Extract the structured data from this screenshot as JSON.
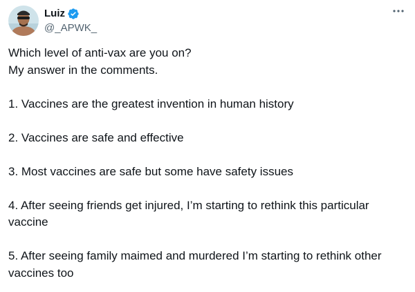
{
  "author": {
    "display_name": "Luiz",
    "handle": "@_APWK_",
    "verified": true,
    "avatar_icon": "profile-photo"
  },
  "post": {
    "intro": [
      "Which level of anti-vax are you on?",
      "My answer in the comments."
    ],
    "items": [
      "1. Vaccines are the greatest invention in human history",
      "2. Vaccines are safe and effective",
      "3. Most vaccines are safe but some have safety issues",
      "4. After seeing friends get injured, I’m starting to rethink this particular vaccine",
      "5. After seeing family maimed and murdered I’m starting to rethink other vaccines too"
    ]
  },
  "colors": {
    "text": "#0f1419",
    "secondary": "#536471",
    "verified_badge": "#1d9bf0"
  },
  "icons": {
    "more": "more-options-icon",
    "verified": "verified-badge-icon"
  }
}
